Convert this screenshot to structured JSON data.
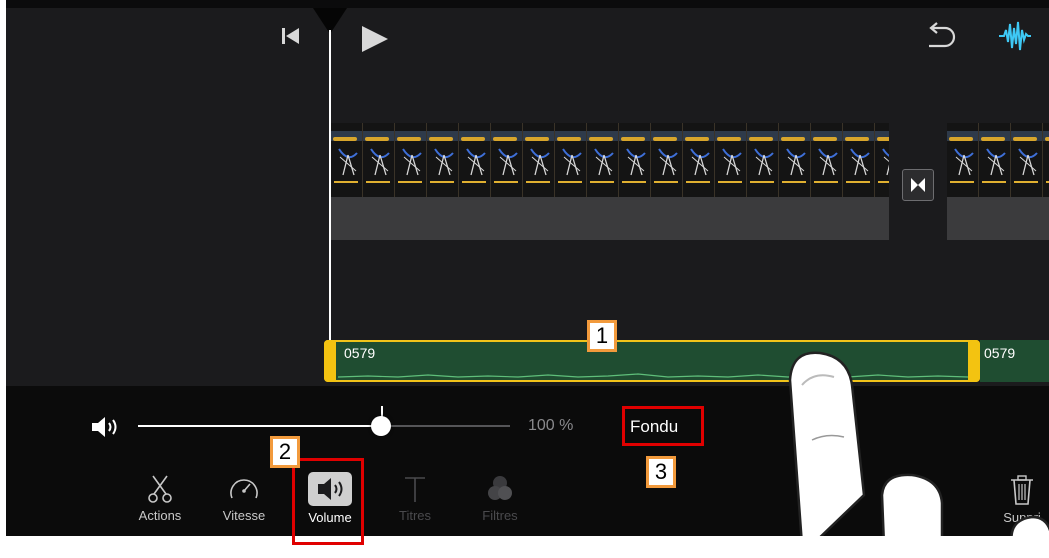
{
  "colors": {
    "editor_bg": "#1b1b1d",
    "panel_bg": "#0b0b0b",
    "accent_waveform": "#3ec9f5",
    "audio_clip": "#1f4d31",
    "clip_selection": "#f1c31a",
    "callout_red": "#e00000",
    "badge_border": "#f29a3c"
  },
  "transport": {
    "icons": [
      "skip-to-start-icon",
      "play-icon",
      "undo-icon",
      "audio-waveform-icon"
    ]
  },
  "timeline": {
    "transition_icon": "bowtie-transition-icon",
    "audio_clip_label": "0579",
    "next_audio_clip_label": "0579"
  },
  "volume": {
    "icon": "speaker-icon",
    "level": 1.0,
    "percent_text": "100 %",
    "fade_label": "Fondu"
  },
  "toolbar": {
    "tools": [
      {
        "label": "Actions",
        "icon": "scissors-icon",
        "state": "normal"
      },
      {
        "label": "Vitesse",
        "icon": "speedometer-icon",
        "state": "normal"
      },
      {
        "label": "Volume",
        "icon": "speaker-icon",
        "state": "selected"
      },
      {
        "label": "Titres",
        "icon": "title-t-icon",
        "state": "disabled"
      },
      {
        "label": "Filtres",
        "icon": "filters-icon",
        "state": "disabled"
      }
    ],
    "delete_label": "Suppri"
  },
  "callouts": [
    {
      "number": "1"
    },
    {
      "number": "2"
    },
    {
      "number": "3"
    }
  ]
}
